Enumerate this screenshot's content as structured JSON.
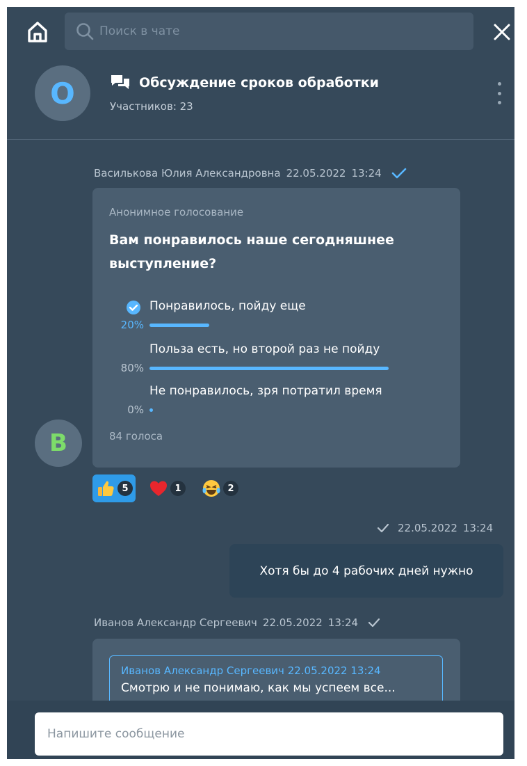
{
  "search": {
    "placeholder": "Поиск в чате"
  },
  "chat": {
    "avatar_letter": "О",
    "title": "Обсуждение сроков обработки",
    "participants": "Участников: 23"
  },
  "messages": [
    {
      "author": "Василькова Юлия Александровна",
      "date": "22.05.2022",
      "time": "13:24",
      "avatar_letter": "В",
      "poll": {
        "label": "Анонимное голосование",
        "question": "Вам понравилось наше сегодняшнее выступление?",
        "options": [
          {
            "text": "Понравилось, пойду еще",
            "percent": "20%",
            "value": 0.2,
            "selected": true
          },
          {
            "text": "Польза есть, но второй раз не пойду",
            "percent": "80%",
            "value": 0.8,
            "selected": false
          },
          {
            "text": "Не понравилось, зря потратил время",
            "percent": "0%",
            "value": 0,
            "selected": false
          }
        ],
        "votes": "84 голоса"
      },
      "reactions": [
        {
          "icon": "thumbs-up-icon",
          "count": "5",
          "active": true
        },
        {
          "icon": "heart-icon",
          "count": "1",
          "active": false
        },
        {
          "icon": "laughing-emoji-icon",
          "count": "2",
          "active": false
        }
      ]
    },
    {
      "own": true,
      "date": "22.05.2022",
      "time": "13:24",
      "text": "Хотя бы до 4 рабочих дней нужно"
    },
    {
      "author": "Иванов Александр Сергеевич",
      "date": "22.05.2022",
      "time": "13:24",
      "quote": {
        "author": "Иванов Александр Сергеевич",
        "date": "22.05.2022",
        "time": "13:24",
        "text": "Смотрю и не понимаю, как мы успеем все..."
      }
    }
  ],
  "composer": {
    "placeholder": "Напишите сообщение"
  },
  "colors": {
    "background": "#36495a",
    "bubble": "#4a5e70",
    "own_bubble": "#2d4457",
    "accent": "#58b7ff",
    "avatar_b": "#7ddc6a"
  }
}
